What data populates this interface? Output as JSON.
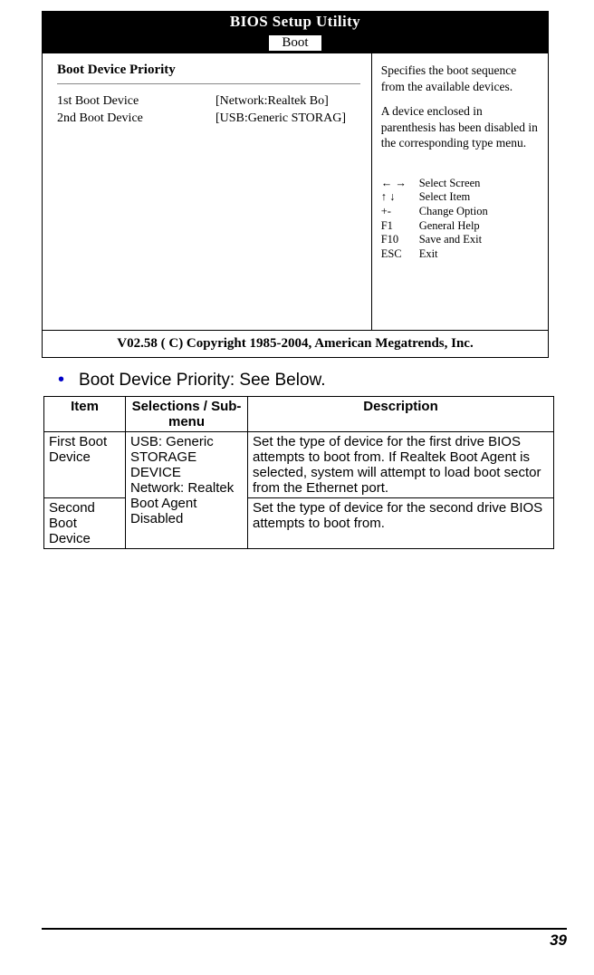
{
  "bios": {
    "title": "BIOS  Setup  Utility",
    "tab": "Boot",
    "heading": "Boot  Device  Priority",
    "dev1_label": "1st  Boot  Device",
    "dev1_value": "[Network:Realtek Bo]",
    "dev2_label": "2nd  Boot  Device",
    "dev2_value": "[USB:Generic STORAG]",
    "help_p1": "Specifies  the  boot sequence  from  the available  devices.",
    "help_p2": "A  device  enclosed  in parenthesis  has  been disabled  in  the corresponding  type menu.",
    "keys": {
      "k1_sym": "← →",
      "k1_txt": "Select Screen",
      "k2_sym": "↑ ↓",
      "k2_txt": "Select Item",
      "k3_sym": "+-",
      "k3_txt": "Change Option",
      "k4_sym": "F1",
      "k4_txt": "General Help",
      "k5_sym": "F10",
      "k5_txt": "Save and Exit",
      "k6_sym": "ESC",
      "k6_txt": "Exit"
    },
    "copyright": "V02.58  ( C) Copyright 1985-2004, American Megatrends, Inc."
  },
  "bullet": {
    "text": "Boot Device Priority: See Below."
  },
  "table": {
    "h1": "Item",
    "h2": "Selections / Sub-menu",
    "h3": "Description",
    "r1_item": "First Boot Device",
    "selections": "USB: Generic STORAGE DEVICE\nNetwork: Realtek Boot Agent\nDisabled",
    "r1_desc": "Set the type of device for the first drive BIOS attempts to boot from. If Realtek Boot Agent is selected, system will attempt to load boot sector from the Ethernet port.",
    "r2_item": "Second Boot Device",
    "r2_desc": "Set the type of device for the second drive BIOS attempts to boot from."
  },
  "page_number": "39"
}
